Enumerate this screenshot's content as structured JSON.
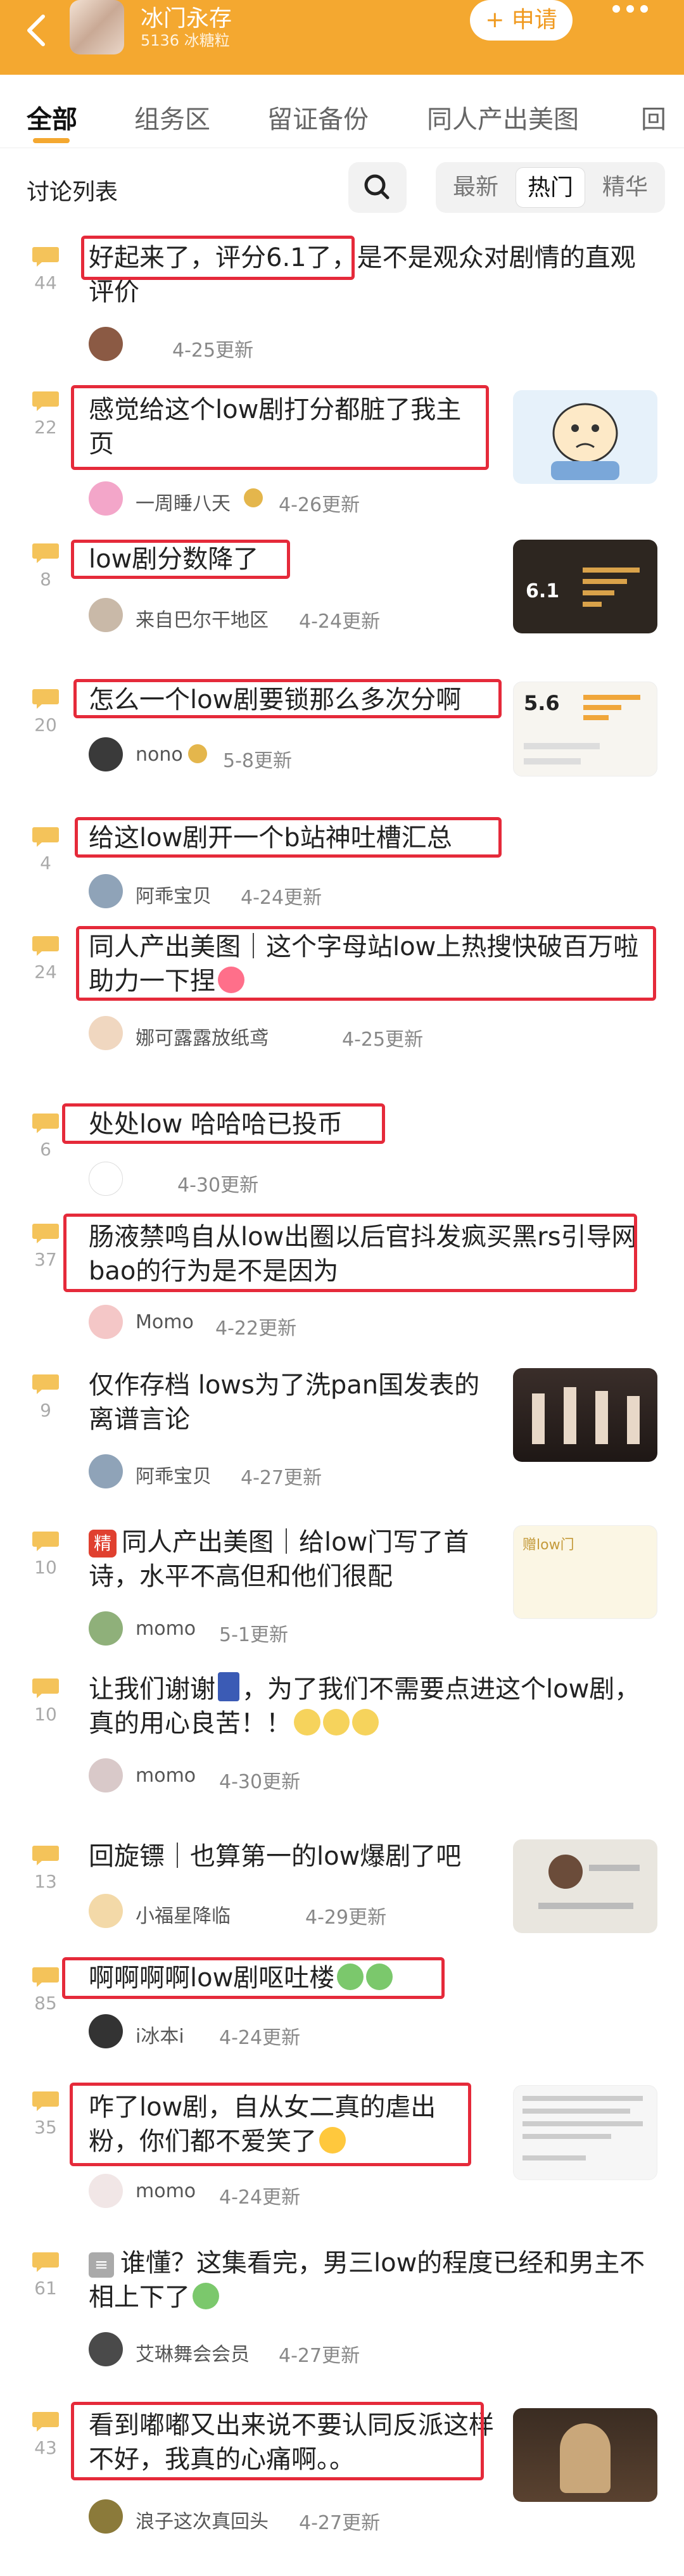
{
  "header": {
    "group_name": "冰门永存",
    "group_sub": "5136 冰糖粒",
    "join_label": "+ 申请"
  },
  "tabs": [
    "全部",
    "组务区",
    "留证备份",
    "同人产出美图",
    "回"
  ],
  "list": {
    "title": "讨论列表",
    "sort": [
      "最新",
      "热门",
      "精华"
    ]
  },
  "posts": [
    {
      "count": "44",
      "title": "好起来了，评分6.1了，是不是观众对剧情的直观评价",
      "author": "",
      "time": "4-25更新"
    },
    {
      "count": "22",
      "title": "感觉给这个low剧打分都脏了我主页",
      "author": "一周睡八天",
      "time": "4-26更新"
    },
    {
      "count": "8",
      "title": "low剧分数降了",
      "author": "来自巴尔干地区",
      "time": "4-24更新"
    },
    {
      "count": "20",
      "title": "怎么一个low剧要锁那么多次分啊",
      "author": "nono",
      "time": "5-8更新"
    },
    {
      "count": "4",
      "title": "给这low剧开一个b站神吐槽汇总",
      "author": "阿乖宝贝",
      "time": "4-24更新"
    },
    {
      "count": "24",
      "title": "同人产出美图｜这个字母站low上热搜快破百万啦 助力一下捏",
      "author": "娜可露露放纸鸢",
      "time": "4-25更新"
    },
    {
      "count": "6",
      "title": "处处low 哈哈哈已投币",
      "author": "",
      "time": "4-30更新"
    },
    {
      "count": "37",
      "title": "肠液禁鸣自从low出圈以后官抖发疯买黑rs引导网bao的行为是不是因为",
      "author": "Momo",
      "time": "4-22更新"
    },
    {
      "count": "9",
      "title": "仅作存档 lows为了洗pan国发表的离谱言论",
      "author": "阿乖宝贝",
      "time": "4-27更新"
    },
    {
      "count": "10",
      "tag": "精",
      "title": "同人产出美图｜给low门写了首诗，水平不高但和他们很配",
      "author": "momo",
      "time": "5-1更新"
    },
    {
      "count": "10",
      "title": "让我们谢谢",
      "title_b": "，为了我们不需要点进这个low剧，真的用心良苦！！",
      "author": "momo",
      "time": "4-30更新"
    },
    {
      "count": "13",
      "title": "回旋镖｜也算第一的low爆剧了吧",
      "author": "小福星降临",
      "time": "4-29更新"
    },
    {
      "count": "85",
      "title": "啊啊啊啊low剧呕吐楼",
      "author": "i冰本i",
      "time": "4-24更新"
    },
    {
      "count": "35",
      "title": "咋了low剧，自从女二真的虐出粉，你们都不爱笑了",
      "author": "momo",
      "time": "4-24更新"
    },
    {
      "count": "61",
      "title": "谁懂？这集看完，男三low的程度已经和男主不相上下了",
      "author": "艾琳舞会会员",
      "time": "4-27更新"
    },
    {
      "count": "43",
      "title": "看到嘟嘟又出来说不要认同反派这样不好，我真的心痛啊。。",
      "author": "浪子这次真回头",
      "time": "4-27更新"
    }
  ],
  "thumb_text": {
    "rating": "5.6",
    "rating2": "6.1",
    "poem_tag": "赠low门"
  },
  "colors": {
    "accent": "#f4a830",
    "highlight": "#e52a3a"
  }
}
